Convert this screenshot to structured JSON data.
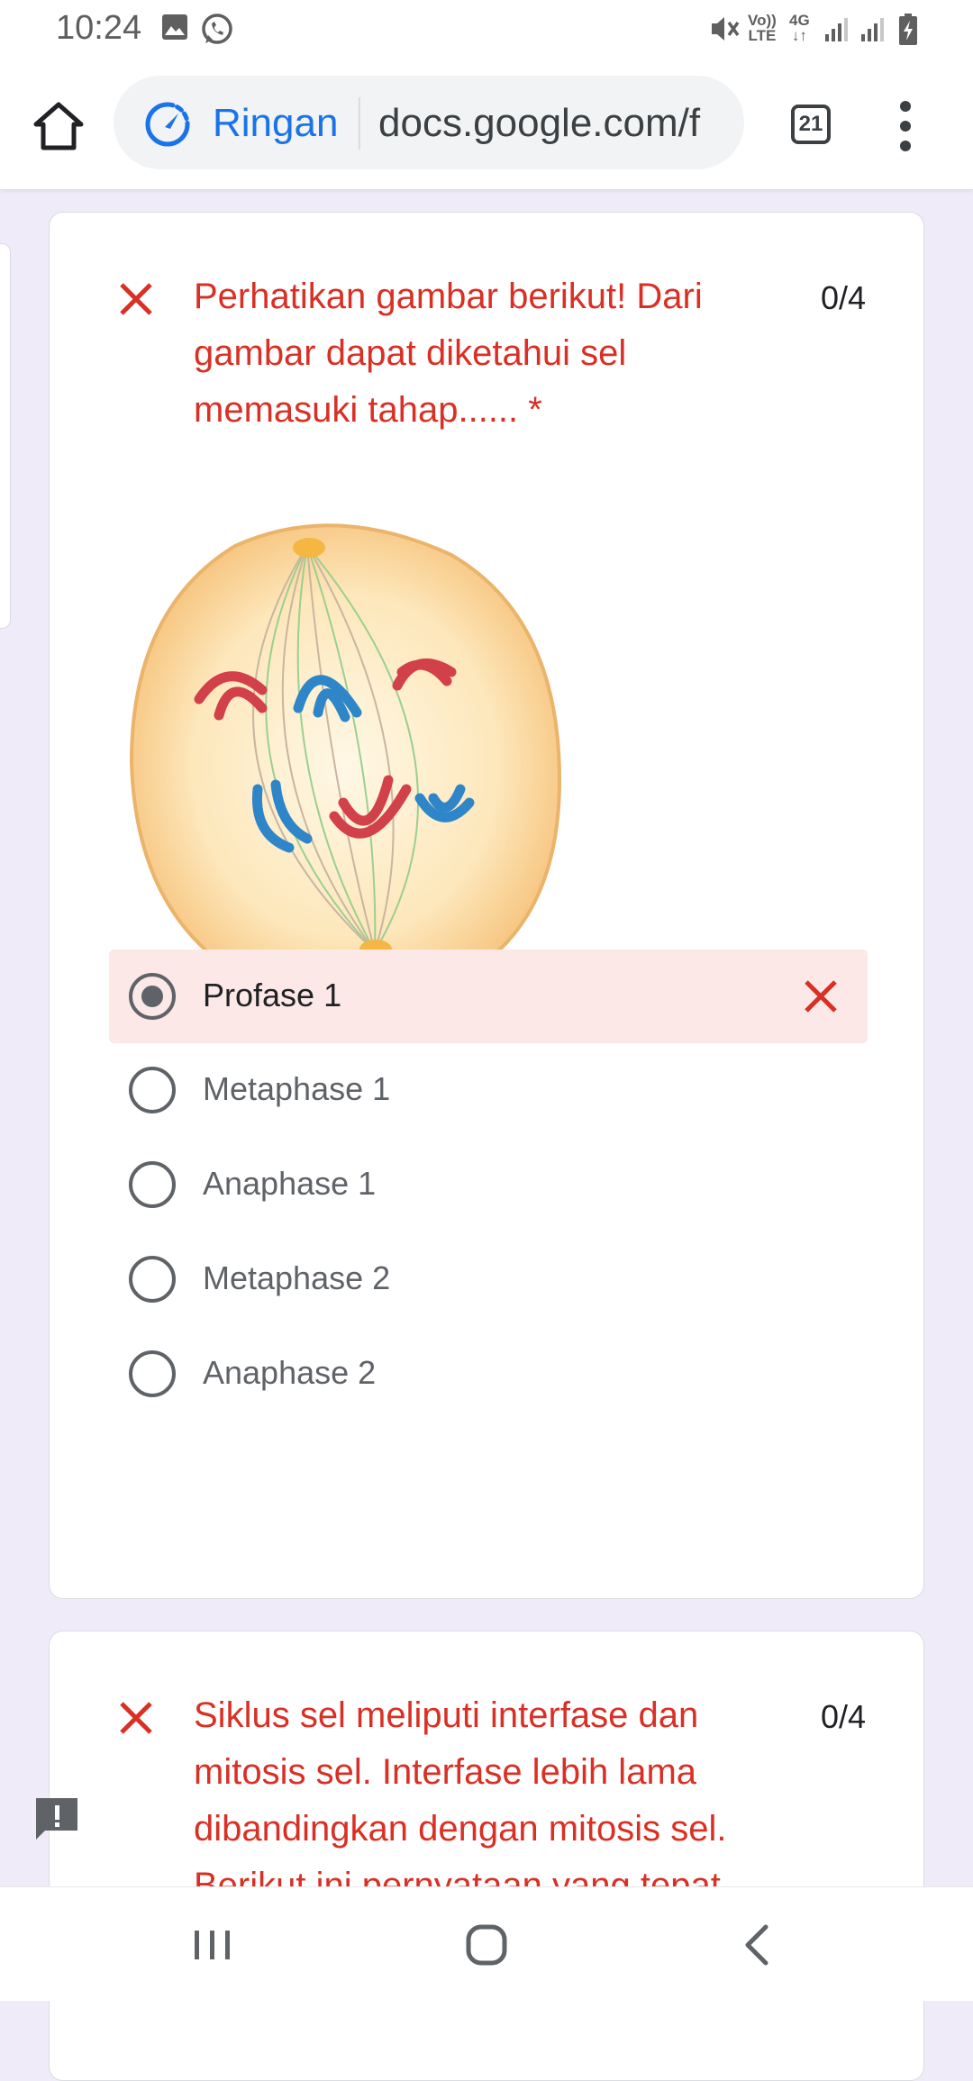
{
  "status": {
    "time": "10:24",
    "network_label_top": "Vo))",
    "network_label_bottom": "LTE",
    "network_gen": "4G",
    "icons": [
      "image-icon",
      "whatsapp-icon",
      "mute-icon",
      "signal-icon",
      "signal-icon",
      "battery-charging-icon"
    ]
  },
  "browser": {
    "lite_label": "Ringan",
    "url": "docs.google.com/f",
    "tab_count": "21",
    "icons": [
      "home-icon",
      "lite-mode-icon",
      "menu-dots-icon"
    ]
  },
  "questions": [
    {
      "text": "Perhatikan gambar berikut! Dari gambar dapat diketahui sel memasuki tahap...... *",
      "score": "0/4",
      "status": "incorrect",
      "image": "cell-division-diagram",
      "options": [
        {
          "label": "Profase 1",
          "selected": true,
          "wrong": true
        },
        {
          "label": "Metaphase 1",
          "selected": false
        },
        {
          "label": "Anaphase 1",
          "selected": false
        },
        {
          "label": "Metaphase 2",
          "selected": false
        },
        {
          "label": "Anaphase 2",
          "selected": false
        }
      ]
    },
    {
      "text": "Siklus sel meliputi interfase dan mitosis sel. Interfase lebih lama dibandingkan dengan mitosis sel. Berikut ini pernyataan yang tepat",
      "score": "0/4",
      "status": "incorrect"
    }
  ],
  "colors": {
    "error": "#d93025",
    "error_bg": "#fce8e6",
    "page_bg": "#f0ebf8",
    "accent": "#1a73e8"
  },
  "navbar": {
    "icons": [
      "recent-apps-icon",
      "home-circle-icon",
      "back-icon"
    ]
  }
}
